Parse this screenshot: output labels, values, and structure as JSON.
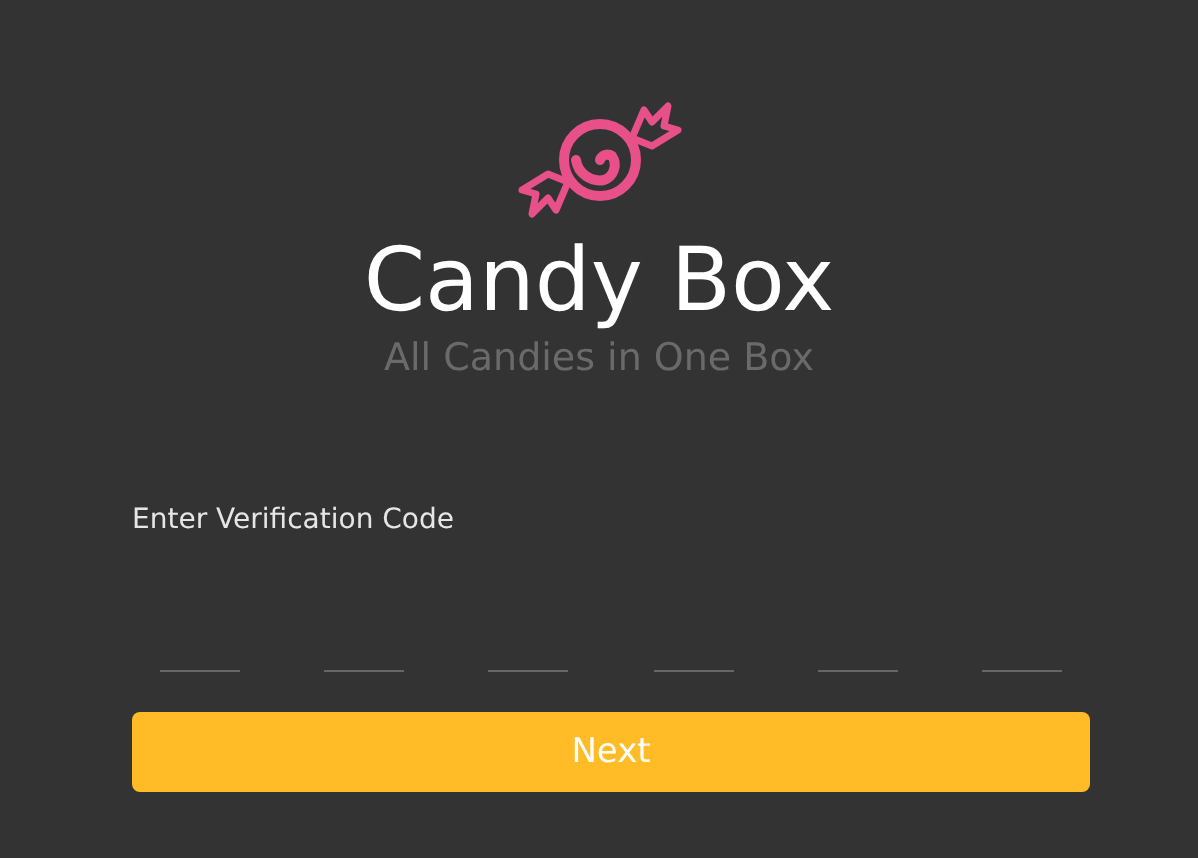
{
  "app": {
    "title": "Candy Box",
    "tagline": "All Candies in One Box"
  },
  "verification": {
    "label": "Enter Verification Code",
    "code_fields": [
      {
        "kind": "digit"
      },
      {
        "kind": "digit"
      },
      {
        "kind": "digit"
      },
      {
        "kind": "digit"
      },
      {
        "kind": "digit"
      },
      {
        "kind": "digit"
      }
    ],
    "button": "Next"
  }
}
